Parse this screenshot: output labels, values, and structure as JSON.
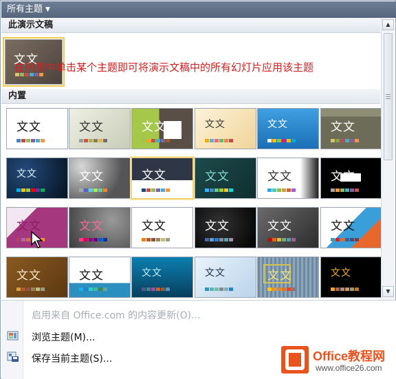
{
  "header": {
    "title": "所有主题"
  },
  "sections": {
    "current": "此演示文稿",
    "builtin": "内置"
  },
  "annotation": "在列表中单击某个主题即可将演示文稿中的所有幻灯片应用该主题",
  "thumb_text": "文文",
  "menu": {
    "update": "启用来自 Office.com 的内容更新(O)...",
    "browse": "浏览主题(M)...",
    "save": "保存当前主题(S)..."
  },
  "watermark": {
    "brand": "Office教程网",
    "url": "www.office26.com"
  }
}
